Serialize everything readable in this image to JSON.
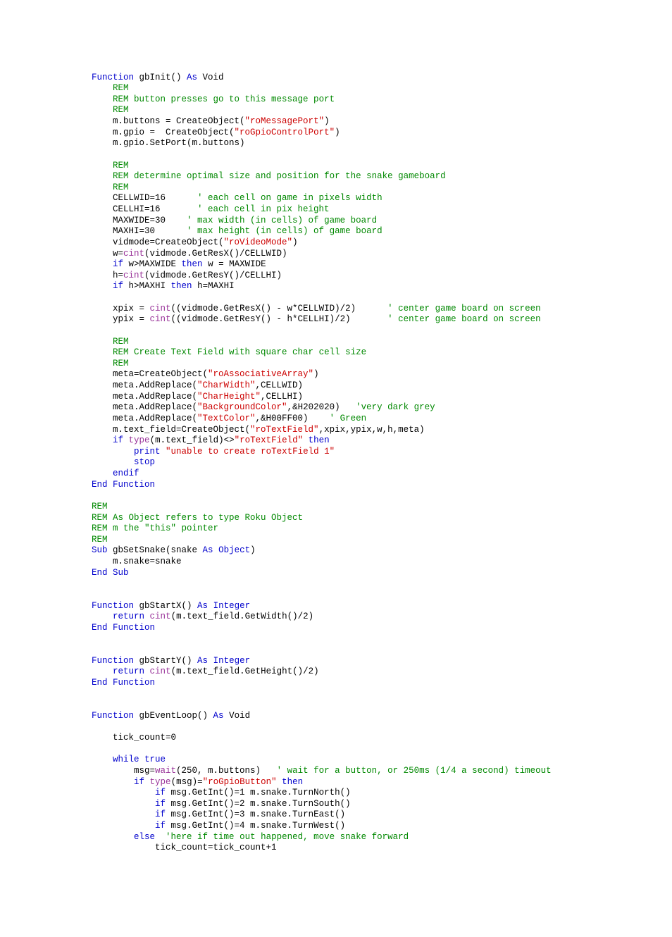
{
  "code": {
    "tokens": [
      [
        [
          "kw",
          "Function"
        ],
        [
          "",
          " gbInit() "
        ],
        [
          "kw",
          "As"
        ],
        [
          "",
          " Void"
        ]
      ],
      [
        [
          "",
          "    "
        ],
        [
          "com",
          "REM"
        ]
      ],
      [
        [
          "",
          "    "
        ],
        [
          "com",
          "REM button presses go to this message port"
        ]
      ],
      [
        [
          "",
          "    "
        ],
        [
          "com",
          "REM"
        ]
      ],
      [
        [
          "",
          "    m.buttons = CreateObject("
        ],
        [
          "str",
          "\"roMessagePort\""
        ],
        [
          "",
          ")"
        ]
      ],
      [
        [
          "",
          "    m.gpio =  CreateObject("
        ],
        [
          "str",
          "\"roGpioControlPort\""
        ],
        [
          "",
          ")"
        ]
      ],
      [
        [
          "",
          "    m.gpio.SetPort(m.buttons)"
        ]
      ],
      [
        [
          "",
          ""
        ]
      ],
      [
        [
          "",
          "    "
        ],
        [
          "com",
          "REM"
        ]
      ],
      [
        [
          "",
          "    "
        ],
        [
          "com",
          "REM determine optimal size and position for the snake gameboard"
        ]
      ],
      [
        [
          "",
          "    "
        ],
        [
          "com",
          "REM"
        ]
      ],
      [
        [
          "",
          "    CELLWID=16      "
        ],
        [
          "com",
          "' each cell on game in pixels width"
        ]
      ],
      [
        [
          "",
          "    CELLHI=16       "
        ],
        [
          "com",
          "' each cell in pix height"
        ]
      ],
      [
        [
          "",
          "    MAXWIDE=30    "
        ],
        [
          "com",
          "' max width (in cells) of game board"
        ]
      ],
      [
        [
          "",
          "    MAXHI=30      "
        ],
        [
          "com",
          "' max height (in cells) of game board"
        ]
      ],
      [
        [
          "",
          "    vidmode=CreateObject("
        ],
        [
          "str",
          "\"roVideoMode\""
        ],
        [
          "",
          ")"
        ]
      ],
      [
        [
          "",
          "    w="
        ],
        [
          "fn",
          "cint"
        ],
        [
          "",
          "(vidmode.GetResX()/CELLWID)"
        ]
      ],
      [
        [
          "",
          "    "
        ],
        [
          "kw",
          "if"
        ],
        [
          "",
          " w>MAXWIDE "
        ],
        [
          "kw",
          "then"
        ],
        [
          "",
          " w = MAXWIDE"
        ]
      ],
      [
        [
          "",
          "    h="
        ],
        [
          "fn",
          "cint"
        ],
        [
          "",
          "(vidmode.GetResY()/CELLHI)"
        ]
      ],
      [
        [
          "",
          "    "
        ],
        [
          "kw",
          "if"
        ],
        [
          "",
          " h>MAXHI "
        ],
        [
          "kw",
          "then"
        ],
        [
          "",
          " h=MAXHI"
        ]
      ],
      [
        [
          "",
          ""
        ]
      ],
      [
        [
          "",
          "    xpix = "
        ],
        [
          "fn",
          "cint"
        ],
        [
          "",
          "((vidmode.GetResX() - w*CELLWID)/2)      "
        ],
        [
          "com",
          "' center game board on screen"
        ]
      ],
      [
        [
          "",
          "    ypix = "
        ],
        [
          "fn",
          "cint"
        ],
        [
          "",
          "((vidmode.GetResY() - h*CELLHI)/2)       "
        ],
        [
          "com",
          "' center game board on screen"
        ]
      ],
      [
        [
          "",
          ""
        ]
      ],
      [
        [
          "",
          "    "
        ],
        [
          "com",
          "REM"
        ]
      ],
      [
        [
          "",
          "    "
        ],
        [
          "com",
          "REM Create Text Field with square char cell size"
        ]
      ],
      [
        [
          "",
          "    "
        ],
        [
          "com",
          "REM"
        ]
      ],
      [
        [
          "",
          "    meta=CreateObject("
        ],
        [
          "str",
          "\"roAssociativeArray\""
        ],
        [
          "",
          ")"
        ]
      ],
      [
        [
          "",
          "    meta.AddReplace("
        ],
        [
          "str",
          "\"CharWidth\""
        ],
        [
          "",
          ",CELLWID)"
        ]
      ],
      [
        [
          "",
          "    meta.AddReplace("
        ],
        [
          "str",
          "\"CharHeight\""
        ],
        [
          "",
          ",CELLHI)"
        ]
      ],
      [
        [
          "",
          "    meta.AddReplace("
        ],
        [
          "str",
          "\"BackgroundColor\""
        ],
        [
          "",
          ",&H202020)   "
        ],
        [
          "com",
          "'very dark grey"
        ]
      ],
      [
        [
          "",
          "    meta.AddReplace("
        ],
        [
          "str",
          "\"TextColor\""
        ],
        [
          "",
          ",&H00FF00)    "
        ],
        [
          "com",
          "' Green"
        ]
      ],
      [
        [
          "",
          "    m.text_field=CreateObject("
        ],
        [
          "str",
          "\"roTextField\""
        ],
        [
          "",
          ",xpix,ypix,w,h,meta)"
        ]
      ],
      [
        [
          "",
          "    "
        ],
        [
          "kw",
          "if"
        ],
        [
          "",
          " "
        ],
        [
          "fn",
          "type"
        ],
        [
          "",
          "(m.text_field)<>"
        ],
        [
          "str",
          "\"roTextField\""
        ],
        [
          "",
          " "
        ],
        [
          "kw",
          "then"
        ]
      ],
      [
        [
          "",
          "        "
        ],
        [
          "kw",
          "print"
        ],
        [
          "",
          " "
        ],
        [
          "str",
          "\"unable to create roTextField 1\""
        ]
      ],
      [
        [
          "",
          "        "
        ],
        [
          "kw",
          "stop"
        ]
      ],
      [
        [
          "",
          "    "
        ],
        [
          "kw",
          "endif"
        ]
      ],
      [
        [
          "kw",
          "End Function"
        ]
      ],
      [
        [
          "",
          ""
        ]
      ],
      [
        [
          "com",
          "REM"
        ]
      ],
      [
        [
          "com",
          "REM As Object refers to type Roku Object"
        ]
      ],
      [
        [
          "com",
          "REM m the \"this\" pointer"
        ]
      ],
      [
        [
          "com",
          "REM"
        ]
      ],
      [
        [
          "kw",
          "Sub"
        ],
        [
          "",
          " gbSetSnake(snake "
        ],
        [
          "kw",
          "As"
        ],
        [
          "",
          " "
        ],
        [
          "kw",
          "Object"
        ],
        [
          "",
          ")"
        ]
      ],
      [
        [
          "",
          "    m.snake=snake"
        ]
      ],
      [
        [
          "kw",
          "End Sub"
        ]
      ],
      [
        [
          "",
          ""
        ]
      ],
      [
        [
          "",
          ""
        ]
      ],
      [
        [
          "kw",
          "Function"
        ],
        [
          "",
          " gbStartX() "
        ],
        [
          "kw",
          "As"
        ],
        [
          "",
          " "
        ],
        [
          "kw",
          "Integer"
        ]
      ],
      [
        [
          "",
          "    "
        ],
        [
          "kw",
          "return"
        ],
        [
          "",
          " "
        ],
        [
          "fn",
          "cint"
        ],
        [
          "",
          "(m.text_field.GetWidth()/2)"
        ]
      ],
      [
        [
          "kw",
          "End Function"
        ]
      ],
      [
        [
          "",
          ""
        ]
      ],
      [
        [
          "",
          ""
        ]
      ],
      [
        [
          "kw",
          "Function"
        ],
        [
          "",
          " gbStartY() "
        ],
        [
          "kw",
          "As"
        ],
        [
          "",
          " "
        ],
        [
          "kw",
          "Integer"
        ]
      ],
      [
        [
          "",
          "    "
        ],
        [
          "kw",
          "return"
        ],
        [
          "",
          " "
        ],
        [
          "fn",
          "cint"
        ],
        [
          "",
          "(m.text_field.GetHeight()/2)"
        ]
      ],
      [
        [
          "kw",
          "End Function"
        ]
      ],
      [
        [
          "",
          ""
        ]
      ],
      [
        [
          "",
          ""
        ]
      ],
      [
        [
          "kw",
          "Function"
        ],
        [
          "",
          " gbEventLoop() "
        ],
        [
          "kw",
          "As"
        ],
        [
          "",
          " Void"
        ]
      ],
      [
        [
          "",
          ""
        ]
      ],
      [
        [
          "",
          "    tick_count=0"
        ]
      ],
      [
        [
          "",
          ""
        ]
      ],
      [
        [
          "",
          "    "
        ],
        [
          "kw",
          "while"
        ],
        [
          "",
          " "
        ],
        [
          "kw",
          "true"
        ]
      ],
      [
        [
          "",
          "        msg="
        ],
        [
          "fn",
          "wait"
        ],
        [
          "",
          "(250, m.buttons)   "
        ],
        [
          "com",
          "' wait for a button, or 250ms (1/4 a second) timeout"
        ]
      ],
      [
        [
          "",
          "        "
        ],
        [
          "kw",
          "if"
        ],
        [
          "",
          " "
        ],
        [
          "fn",
          "type"
        ],
        [
          "",
          "(msg)="
        ],
        [
          "str",
          "\"roGpioButton\""
        ],
        [
          "",
          " "
        ],
        [
          "kw",
          "then"
        ]
      ],
      [
        [
          "",
          "            "
        ],
        [
          "kw",
          "if"
        ],
        [
          "",
          " msg.GetInt()=1 m.snake.TurnNorth()"
        ]
      ],
      [
        [
          "",
          "            "
        ],
        [
          "kw",
          "if"
        ],
        [
          "",
          " msg.GetInt()=2 m.snake.TurnSouth()"
        ]
      ],
      [
        [
          "",
          "            "
        ],
        [
          "kw",
          "if"
        ],
        [
          "",
          " msg.GetInt()=3 m.snake.TurnEast()"
        ]
      ],
      [
        [
          "",
          "            "
        ],
        [
          "kw",
          "if"
        ],
        [
          "",
          " msg.GetInt()=4 m.snake.TurnWest()"
        ]
      ],
      [
        [
          "",
          "        "
        ],
        [
          "kw",
          "else"
        ],
        [
          "",
          "  "
        ],
        [
          "com",
          "'here if time out happened, move snake forward"
        ]
      ],
      [
        [
          "",
          "            tick_count=tick_count+1"
        ]
      ]
    ]
  }
}
